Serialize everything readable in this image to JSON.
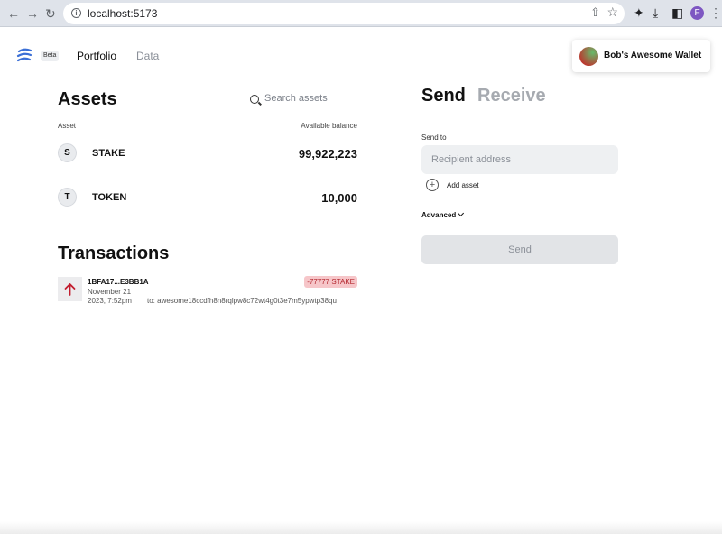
{
  "browser": {
    "url": "localhost:5173",
    "profile_initial": "F"
  },
  "header": {
    "beta_label": "Beta",
    "nav": {
      "portfolio": "Portfolio",
      "data": "Data"
    },
    "wallet_name": "Bob's Awesome Wallet"
  },
  "assets": {
    "title": "Assets",
    "search_placeholder": "Search assets",
    "col_asset": "Asset",
    "col_balance": "Available balance",
    "rows": [
      {
        "letter": "S",
        "symbol": "STAKE",
        "balance": "99,922,223"
      },
      {
        "letter": "T",
        "symbol": "TOKEN",
        "balance": "10,000"
      }
    ]
  },
  "transactions": {
    "title": "Transactions",
    "items": [
      {
        "hash": "1BFA17...E3BB1A",
        "date_line1": "November 21",
        "date_line2": "2023, 7:52pm",
        "to": "to: awesome18ccdfh8n8rqlpw8c72wt4g0t3e7m5ypwtp38qu",
        "amount": "-77777 STAKE"
      }
    ]
  },
  "send_panel": {
    "tab_send": "Send",
    "tab_receive": "Receive",
    "send_to_label": "Send to",
    "recipient_placeholder": "Recipient address",
    "add_asset_label": "Add asset",
    "advanced_label": "Advanced",
    "send_button": "Send"
  },
  "colors": {
    "accent_blue": "#3b6fd6",
    "amount_bg": "#f6c6c9",
    "amount_fg": "#b3262e",
    "arrow_red": "#c21d2e"
  }
}
